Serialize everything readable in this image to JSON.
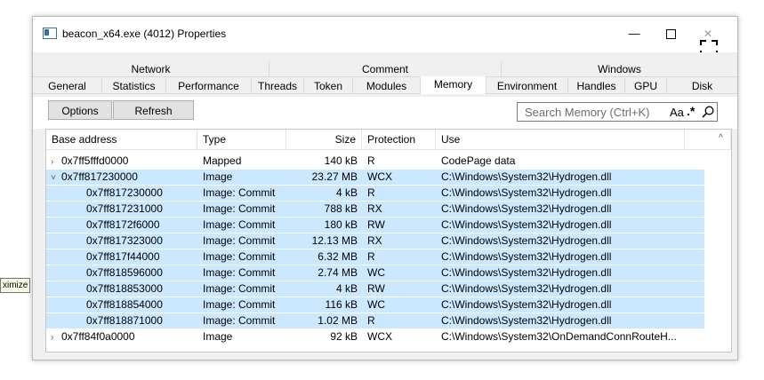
{
  "tooltip": "ximize",
  "window": {
    "title": "beacon_x64.exe (4012) Properties",
    "minimize": "—",
    "close": "✕"
  },
  "tabs_row1": [
    "Network",
    "Comment",
    "Windows"
  ],
  "tabs_row2": [
    "General",
    "Statistics",
    "Performance",
    "Threads",
    "Token",
    "Modules",
    "Memory",
    "Environment",
    "Handles",
    "GPU",
    "Disk"
  ],
  "toolbar": {
    "options_label": "Options",
    "refresh_label": "Refresh",
    "search_placeholder": "Search Memory (Ctrl+K)",
    "case_label": "Aa",
    "regex_label": ".*"
  },
  "columns": [
    "Base address",
    "Type",
    "Size",
    "Protection",
    "Use"
  ],
  "rows": [
    {
      "base": "0x7ff5fffd0000",
      "type": "Mapped",
      "size": "140 kB",
      "prot": "R",
      "use": "CodePage data",
      "chevron": "›",
      "selected": false
    },
    {
      "base": "0x7ff817230000",
      "type": "Image",
      "size": "23.27 MB",
      "prot": "WCX",
      "use": "C:\\Windows\\System32\\Hydrogen.dll",
      "chevron": "˅",
      "selected": true
    },
    {
      "base": "0x7ff817230000",
      "type": "Image: Commit",
      "size": "4 kB",
      "prot": "R",
      "use": "C:\\Windows\\System32\\Hydrogen.dll",
      "selected": true
    },
    {
      "base": "0x7ff817231000",
      "type": "Image: Commit",
      "size": "788 kB",
      "prot": "RX",
      "use": "C:\\Windows\\System32\\Hydrogen.dll",
      "selected": true
    },
    {
      "base": "0x7ff8172f6000",
      "type": "Image: Commit",
      "size": "180 kB",
      "prot": "RW",
      "use": "C:\\Windows\\System32\\Hydrogen.dll",
      "selected": true
    },
    {
      "base": "0x7ff817323000",
      "type": "Image: Commit",
      "size": "12.13 MB",
      "prot": "RX",
      "use": "C:\\Windows\\System32\\Hydrogen.dll",
      "selected": true
    },
    {
      "base": "0x7ff817f44000",
      "type": "Image: Commit",
      "size": "6.32 MB",
      "prot": "R",
      "use": "C:\\Windows\\System32\\Hydrogen.dll",
      "selected": true
    },
    {
      "base": "0x7ff818596000",
      "type": "Image: Commit",
      "size": "2.74 MB",
      "prot": "WC",
      "use": "C:\\Windows\\System32\\Hydrogen.dll",
      "selected": true
    },
    {
      "base": "0x7ff818853000",
      "type": "Image: Commit",
      "size": "4 kB",
      "prot": "RW",
      "use": "C:\\Windows\\System32\\Hydrogen.dll",
      "selected": true
    },
    {
      "base": "0x7ff818854000",
      "type": "Image: Commit",
      "size": "116 kB",
      "prot": "WC",
      "use": "C:\\Windows\\System32\\Hydrogen.dll",
      "selected": true
    },
    {
      "base": "0x7ff818871000",
      "type": "Image: Commit",
      "size": "1.02 MB",
      "prot": "R",
      "use": "C:\\Windows\\System32\\Hydrogen.dll",
      "selected": true
    },
    {
      "base": "0x7ff84f0a0000",
      "type": "Image",
      "size": "92 kB",
      "prot": "WCX",
      "use": "C:\\Windows\\System32\\OnDemandConnRouteH...",
      "chevron": "›",
      "selected": false
    }
  ]
}
